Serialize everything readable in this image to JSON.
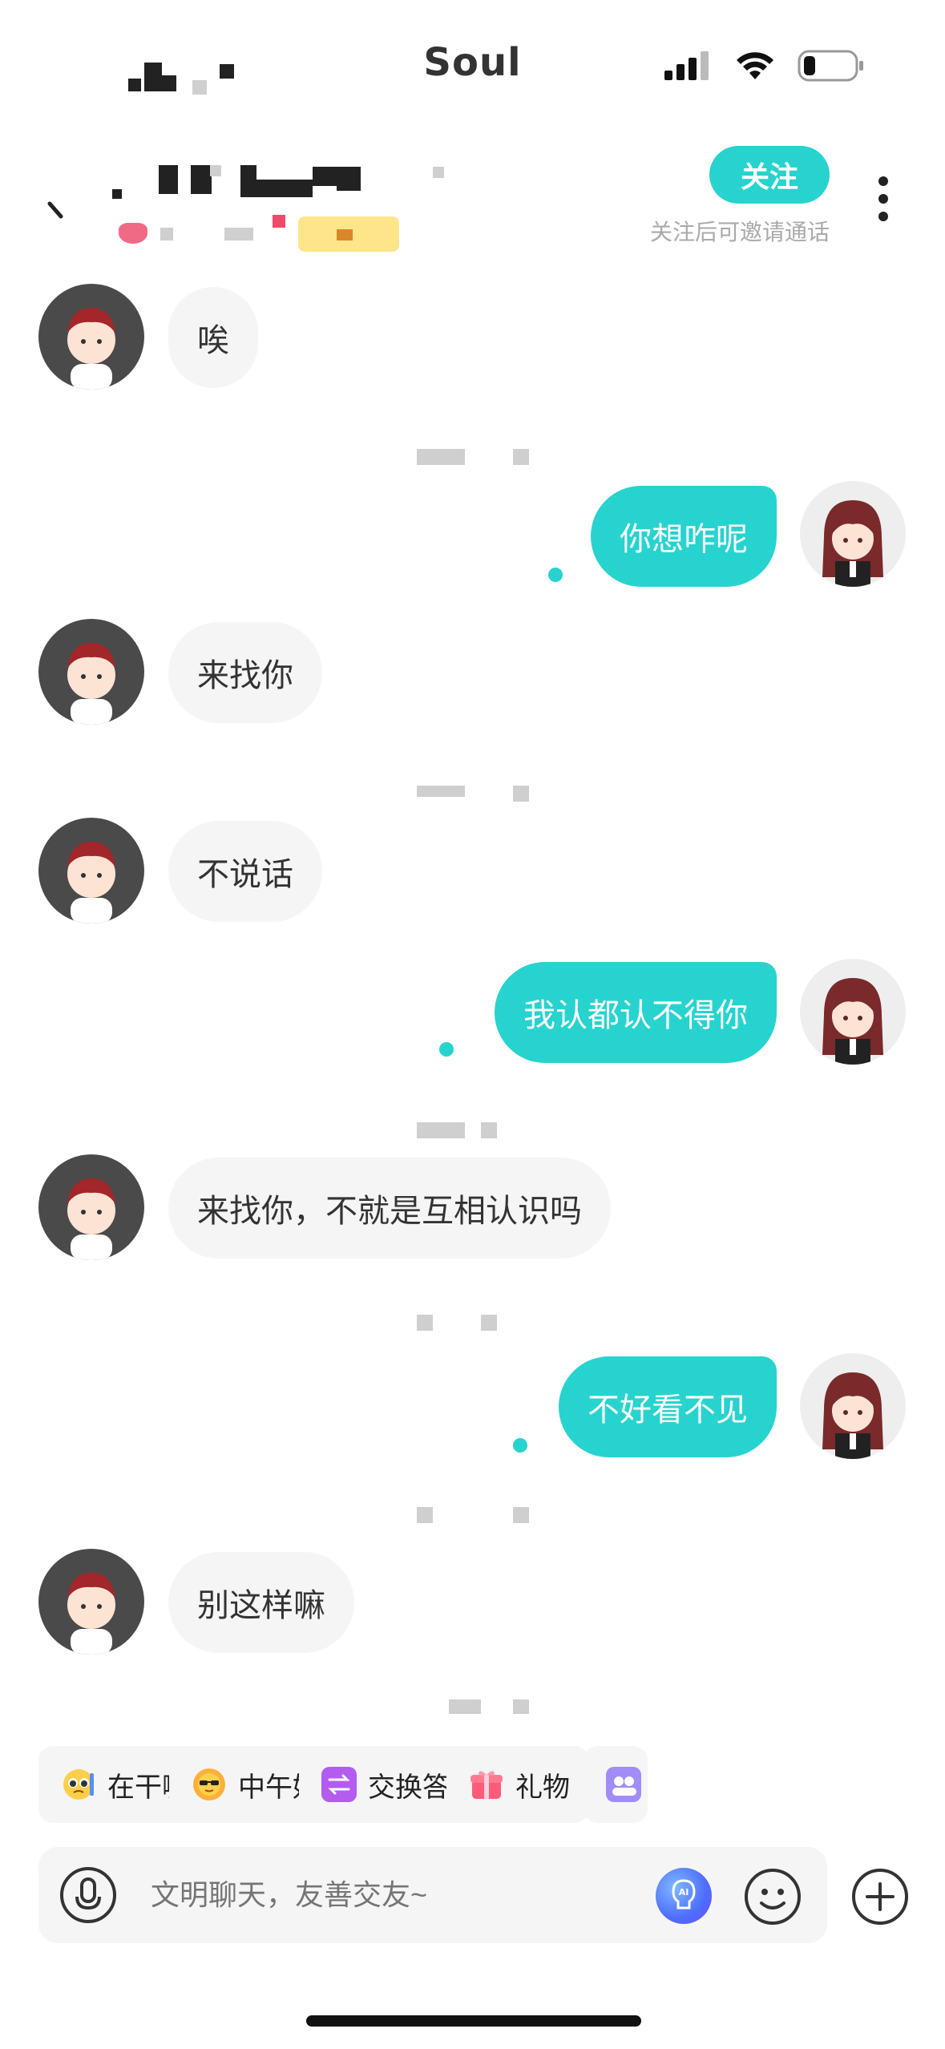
{
  "status_bar": {
    "app_name": "Soul"
  },
  "header": {
    "follow_label": "关注",
    "follow_tip": "关注后可邀请通话"
  },
  "messages": [
    {
      "side": "in",
      "text": "唉"
    },
    {
      "side": "out",
      "text": "你想咋呢"
    },
    {
      "side": "in",
      "text": "来找你"
    },
    {
      "side": "in",
      "text": "不说话"
    },
    {
      "side": "out",
      "text": "我认都认不得你"
    },
    {
      "side": "in",
      "text": "来找你，不就是互相认识吗"
    },
    {
      "side": "out",
      "text": "不好看不见"
    },
    {
      "side": "in",
      "text": "别这样嘛"
    }
  ],
  "quick_chips": [
    {
      "label": "在干嘛",
      "icon": "pleading-face-icon"
    },
    {
      "label": "中午好",
      "icon": "sun-sunglasses-icon"
    },
    {
      "label": "交换答案",
      "icon": "swap-bubble-icon"
    },
    {
      "label": "礼物",
      "icon": "gift-icon"
    }
  ],
  "input": {
    "placeholder": "文明聊天，友善交友~"
  },
  "colors": {
    "accent": "#27d3cf",
    "bubble_in": "#f5f5f5",
    "muted_text": "#aaaaaa"
  }
}
